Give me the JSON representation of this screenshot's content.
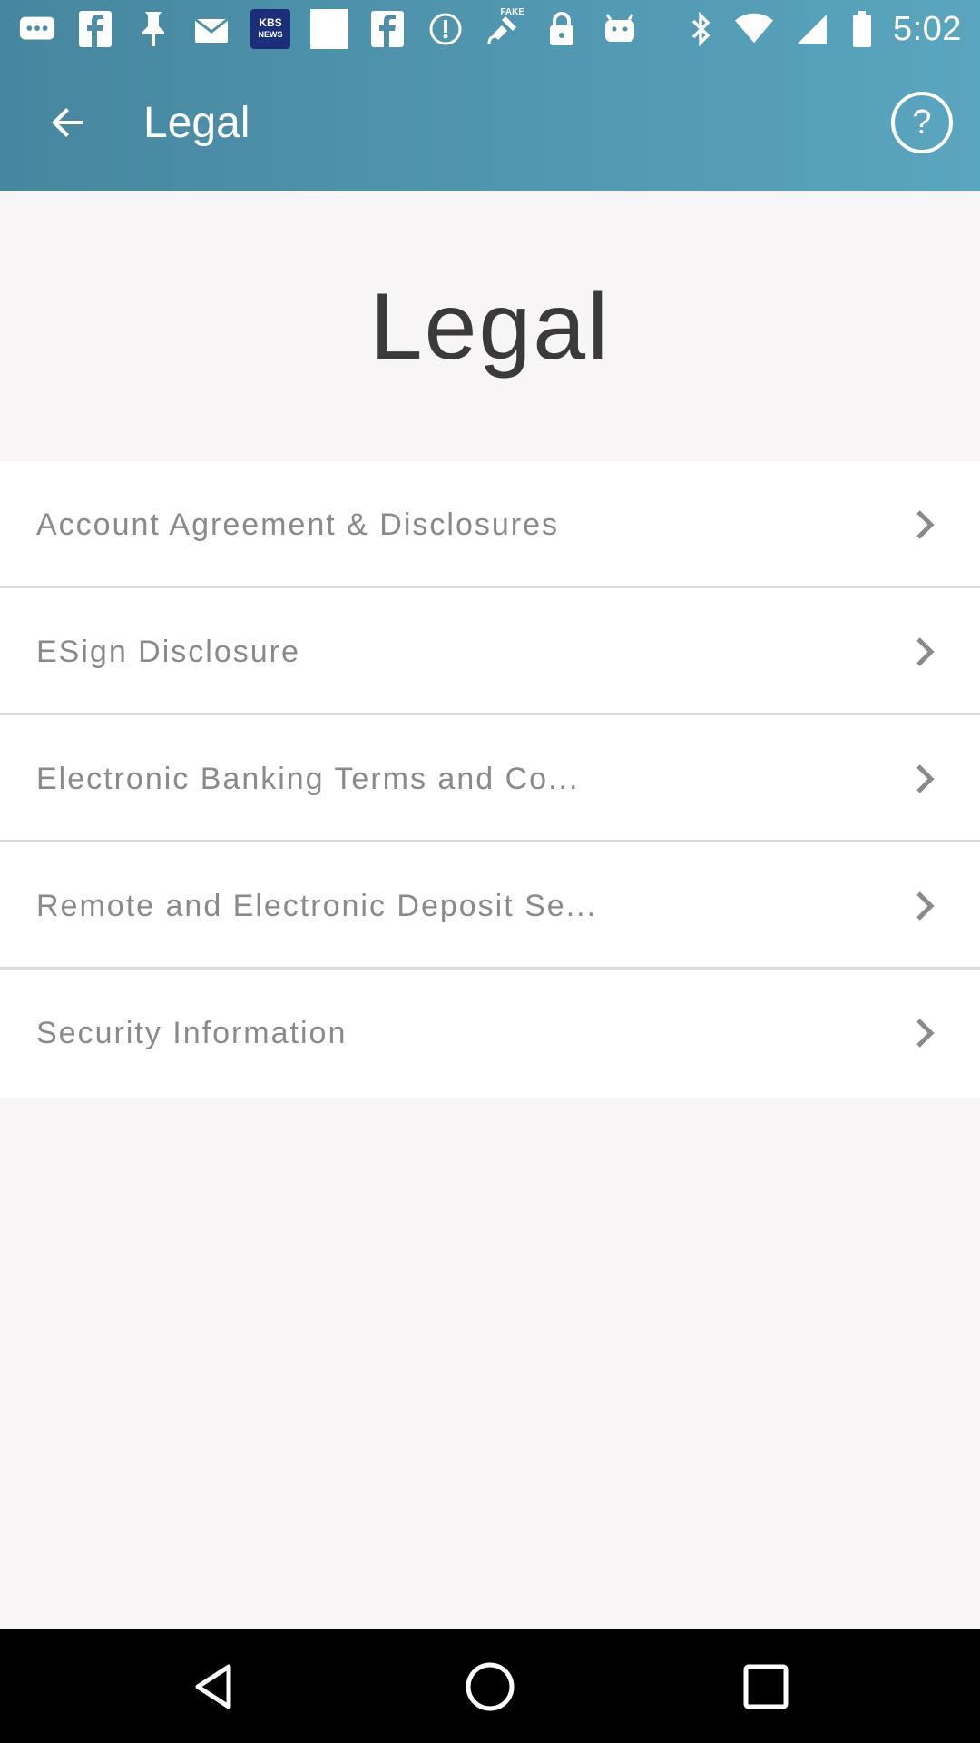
{
  "status_bar": {
    "time": "5:02",
    "icons": [
      "messages-icon",
      "facebook-icon",
      "pin-icon",
      "mail-icon",
      "kbs-news-icon",
      "blank-icon",
      "facebook-icon",
      "settings-icon",
      "fake-gps-icon",
      "lock-icon",
      "android-icon",
      "bluetooth-icon",
      "wifi-icon",
      "signal-icon",
      "battery-icon"
    ],
    "kbs_badge_line1": "KBS",
    "kbs_badge_line2": "NEWS",
    "fake_badge": "FAKE"
  },
  "toolbar": {
    "title": "Legal",
    "back_icon": "arrow-back-icon",
    "help_label": "?"
  },
  "page": {
    "heading": "Legal"
  },
  "legal_items": [
    {
      "label": "Account Agreement & Disclosures"
    },
    {
      "label": "ESign Disclosure"
    },
    {
      "label": "Electronic Banking Terms and Co..."
    },
    {
      "label": "Remote and Electronic Deposit Se..."
    },
    {
      "label": "Security Information"
    }
  ],
  "nav_bar": {
    "icons": [
      "back-triangle-icon",
      "home-circle-icon",
      "recents-square-icon"
    ]
  },
  "colors": {
    "app_bar_start": "#47869f",
    "app_bar_end": "#5aa5bf",
    "background": "#f7f5f6",
    "list_text": "#8a8a8a",
    "heading_text": "#3a3a3a"
  }
}
